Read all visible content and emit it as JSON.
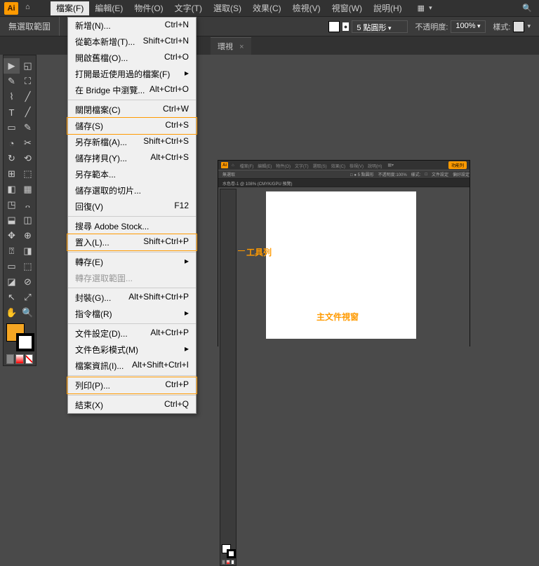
{
  "menubar": {
    "items": [
      "檔案(F)",
      "編輯(E)",
      "物件(O)",
      "文字(T)",
      "選取(S)",
      "效果(C)",
      "檢視(V)",
      "視窗(W)",
      "說明(H)"
    ]
  },
  "noSelectionLabel": "無選取範圍",
  "options": {
    "strokeLabel": "5 點圓形",
    "opacityLabel": "不透明度:",
    "opacityValue": "100%",
    "styleLabel": "樣式:"
  },
  "tab": {
    "title": "環視",
    "close": "×"
  },
  "fileMenu": [
    {
      "label": "新增(N)...",
      "shortcut": "Ctrl+N"
    },
    {
      "label": "從範本新增(T)...",
      "shortcut": "Shift+Ctrl+N"
    },
    {
      "label": "開啟舊檔(O)...",
      "shortcut": "Ctrl+O"
    },
    {
      "label": "打開最近使用過的檔案(F)",
      "shortcut": "▸"
    },
    {
      "label": "在 Bridge 中瀏覽...",
      "shortcut": "Alt+Ctrl+O"
    },
    {
      "sep": true
    },
    {
      "label": "關閉檔案(C)",
      "shortcut": "Ctrl+W"
    },
    {
      "label": "儲存(S)",
      "shortcut": "Ctrl+S",
      "hl": "save"
    },
    {
      "label": "另存新檔(A)...",
      "shortcut": "Shift+Ctrl+S"
    },
    {
      "label": "儲存拷貝(Y)...",
      "shortcut": "Alt+Ctrl+S"
    },
    {
      "label": "另存範本..."
    },
    {
      "label": "儲存選取的切片..."
    },
    {
      "label": "回復(V)",
      "shortcut": "F12"
    },
    {
      "sep": true
    },
    {
      "label": "搜尋 Adobe Stock..."
    },
    {
      "label": "置入(L)...",
      "shortcut": "Shift+Ctrl+P",
      "hl": "place"
    },
    {
      "sep": true
    },
    {
      "label": "轉存(E)",
      "shortcut": "▸"
    },
    {
      "label": "轉存選取範圍...",
      "disabled": true
    },
    {
      "sep": true
    },
    {
      "label": "封裝(G)...",
      "shortcut": "Alt+Shift+Ctrl+P"
    },
    {
      "label": "指令檔(R)",
      "shortcut": "▸"
    },
    {
      "sep": true
    },
    {
      "label": "文件設定(D)...",
      "shortcut": "Alt+Ctrl+P"
    },
    {
      "label": "文件色彩模式(M)",
      "shortcut": "▸"
    },
    {
      "label": "檔案資訊(I)...",
      "shortcut": "Alt+Shift+Ctrl+I"
    },
    {
      "sep": true
    },
    {
      "label": "列印(P)...",
      "shortcut": "Ctrl+P",
      "hl": "print"
    },
    {
      "sep": true
    },
    {
      "label": "結束(X)",
      "shortcut": "Ctrl+Q"
    }
  ],
  "mini": {
    "menubar": [
      "檔案(F)",
      "編輯(E)",
      "物件(O)",
      "文字(T)",
      "選取(S)",
      "效果(C)",
      "檢視(V)",
      "說明(H)"
    ],
    "functionBarLabel": "功能列",
    "ctrl": {
      "noSel": "無選取",
      "stroke": "5 點圓形",
      "opLab": "不透明度:",
      "opVal": "100%",
      "style": "樣式:",
      "docSet": "文件設定",
      "pref": "偏好設定"
    },
    "tabTitle": "水色卷-1 @ 108% (CMYK/GPU 預覽)",
    "toolbarLabel": "工具列",
    "canvasLabel": "主文件視窗"
  },
  "icons": {
    "home": "⌂",
    "grid": "▦",
    "search": "🔍",
    "tools": [
      "▶",
      "◱",
      "✎",
      "⛶",
      "⌇",
      "╱",
      "T",
      "╱",
      "▭",
      "✎",
      "◔",
      "✂",
      "↻",
      "⟲",
      "⊞",
      "⬚",
      "◧",
      "▦",
      "◳",
      "᎔",
      "⬓",
      "◫",
      "✥",
      "⊕",
      "⍰",
      "◨",
      "▭",
      "⬚",
      "◪",
      "⊘",
      "↖",
      "⤢",
      "✋",
      "🔍"
    ]
  }
}
